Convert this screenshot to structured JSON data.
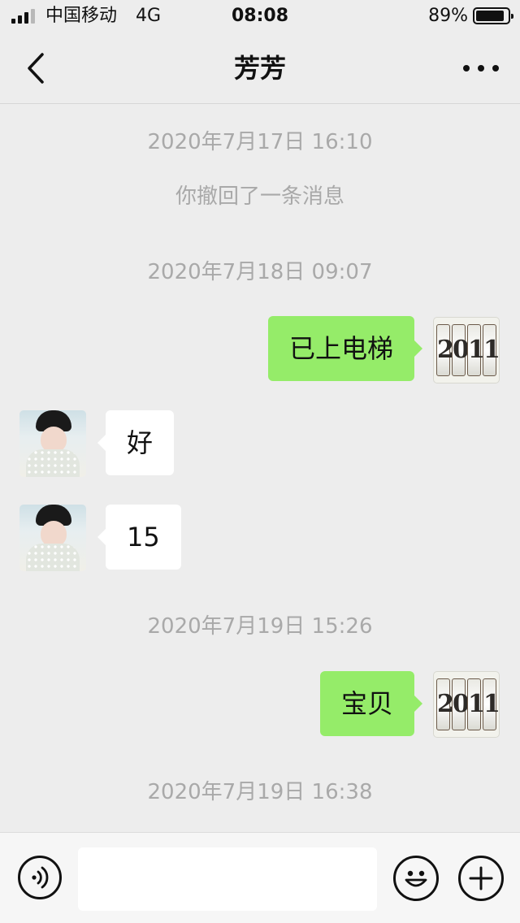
{
  "status_bar": {
    "carrier": "中国移动",
    "network": "4G",
    "time": "08:08",
    "battery": "89%",
    "battery_level": 0.89,
    "signal_bars": 3
  },
  "nav": {
    "title": "芳芳",
    "back_icon": "chevron-left-icon",
    "more_icon": "more-dots-icon"
  },
  "messages": [
    {
      "kind": "timestamp",
      "text": "2020年7月17日 16:10"
    },
    {
      "kind": "system",
      "text": "你撤回了一条消息"
    },
    {
      "kind": "timestamp",
      "text": "2020年7月18日 09:07"
    },
    {
      "kind": "sent",
      "text": "已上电梯",
      "avatar_text": "2011"
    },
    {
      "kind": "received",
      "text": "好"
    },
    {
      "kind": "received",
      "text": "15"
    },
    {
      "kind": "timestamp",
      "text": "2020年7月19日 15:26"
    },
    {
      "kind": "sent",
      "text": "宝贝",
      "avatar_text": "2011"
    },
    {
      "kind": "timestamp",
      "text": "2020年7月19日 16:38"
    }
  ],
  "input_bar": {
    "voice_icon": "voice-icon",
    "placeholder": "",
    "emoji_icon": "emoji-icon",
    "plus_icon": "plus-icon"
  },
  "colors": {
    "background": "#ededed",
    "sent_bubble": "#95ec69",
    "received_bubble": "#ffffff",
    "timestamp_text": "#a9a9a9"
  }
}
